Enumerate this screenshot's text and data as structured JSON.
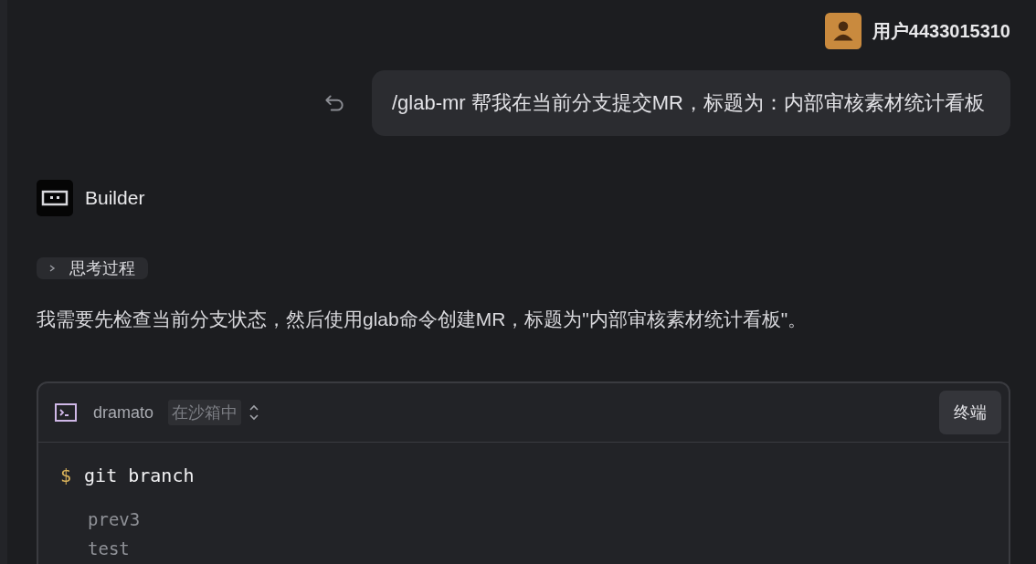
{
  "user": {
    "name": "用户4433015310"
  },
  "message": {
    "text": "/glab-mr 帮我在当前分支提交MR，标题为：内部审核素材统计看板"
  },
  "assistant": {
    "name": "Builder"
  },
  "thinking": {
    "label": "思考过程",
    "expanded": false
  },
  "reply": "我需要先检查当前分支状态，然后使用glab命令创建MR，标题为\"内部审核素材统计看板\"。",
  "terminal": {
    "project": "dramato",
    "mode": "在沙箱中",
    "button": "终端",
    "prompt": "$",
    "command": "git branch",
    "output": [
      "prev3",
      "test"
    ]
  }
}
